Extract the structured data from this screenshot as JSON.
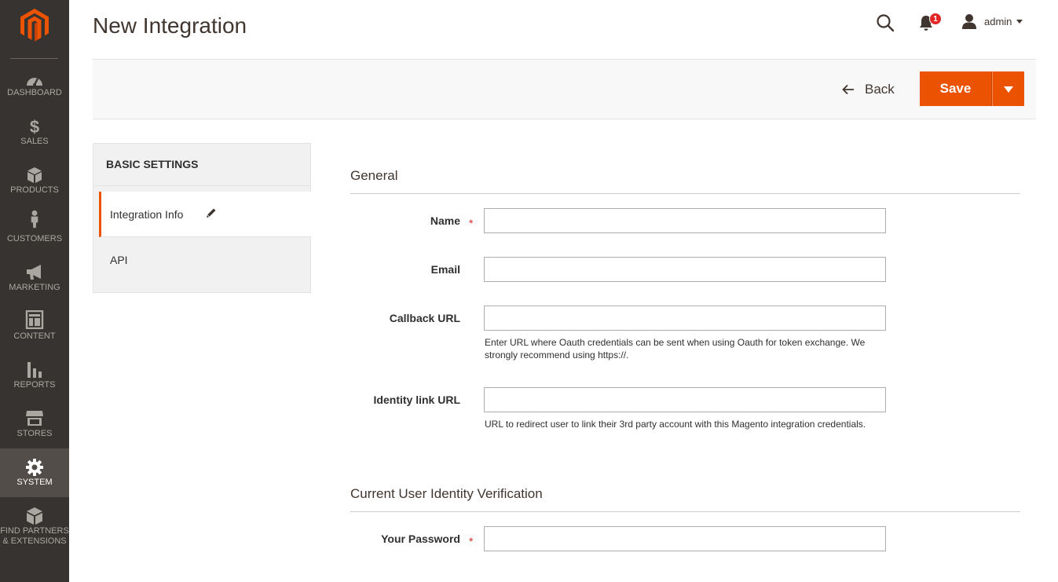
{
  "app": {
    "brand_color": "#eb5202",
    "sidebar_color": "#373330"
  },
  "sidebar": {
    "items": [
      {
        "label": "DASHBOARD",
        "icon": "dashboard-icon"
      },
      {
        "label": "SALES",
        "icon": "dollar-icon"
      },
      {
        "label": "PRODUCTS",
        "icon": "cube-icon"
      },
      {
        "label": "CUSTOMERS",
        "icon": "person-icon"
      },
      {
        "label": "MARKETING",
        "icon": "megaphone-icon"
      },
      {
        "label": "CONTENT",
        "icon": "layout-icon"
      },
      {
        "label": "REPORTS",
        "icon": "bar-chart-icon"
      },
      {
        "label": "STORES",
        "icon": "storefront-icon"
      },
      {
        "label": "SYSTEM",
        "icon": "gear-icon",
        "active": true
      },
      {
        "label": "FIND PARTNERS",
        "label2": "& EXTENSIONS",
        "icon": "blocks-icon"
      }
    ]
  },
  "header": {
    "title": "New Integration",
    "notifications_count": "1",
    "user": "admin"
  },
  "actions": {
    "back_label": "Back",
    "save_label": "Save"
  },
  "tabs": {
    "title": "BASIC SETTINGS",
    "items": [
      {
        "label": "Integration Info",
        "active": true
      },
      {
        "label": "API"
      }
    ]
  },
  "form": {
    "general": {
      "title": "General",
      "name_label": "Name",
      "email_label": "Email",
      "callback_label": "Callback URL",
      "callback_note": "Enter URL where Oauth credentials can be sent when using Oauth for token exchange. We strongly recommend using https://.",
      "identity_label": "Identity link URL",
      "identity_note": "URL to redirect user to link their 3rd party account with this Magento integration credentials.",
      "name_value": "",
      "email_value": "",
      "callback_value": "",
      "identity_value": ""
    },
    "verification": {
      "title": "Current User Identity Verification",
      "password_label": "Your Password",
      "password_value": ""
    },
    "required_mark": "*"
  }
}
